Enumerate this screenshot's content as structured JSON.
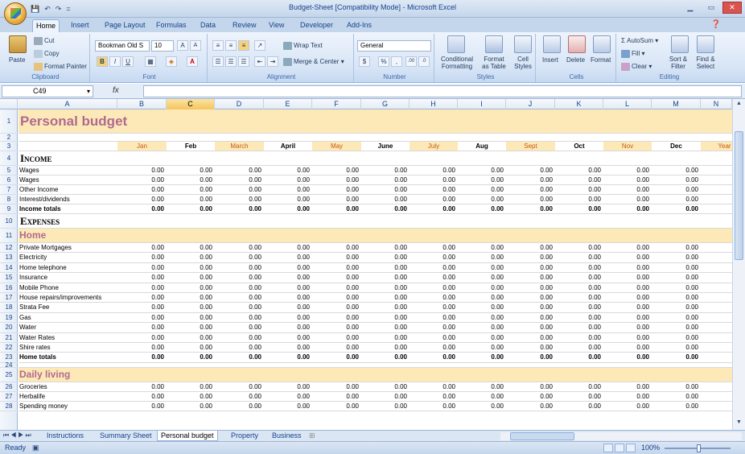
{
  "window": {
    "title": "Budget-Sheet  [Compatibility Mode] - Microsoft Excel"
  },
  "qat": {
    "save": "💾",
    "undo": "↶",
    "redo": "↷",
    "more": "="
  },
  "ribbon_tabs": [
    "Home",
    "Insert",
    "Page Layout",
    "Formulas",
    "Data",
    "Review",
    "View",
    "Developer",
    "Add-Ins"
  ],
  "ribbon": {
    "clipboard": {
      "label": "Clipboard",
      "paste": "Paste",
      "cut": "Cut",
      "copy": "Copy",
      "format_painter": "Format Painter"
    },
    "font": {
      "label": "Font",
      "name": "Bookman Old S",
      "size": "10",
      "bold": "B",
      "italic": "I",
      "underline": "U",
      "grow": "A",
      "shrink": "A"
    },
    "alignment": {
      "label": "Alignment",
      "wrap_text": "Wrap Text",
      "merge_center": "Merge & Center"
    },
    "number": {
      "label": "Number",
      "format": "General",
      "percent": "%",
      "comma": ","
    },
    "styles": {
      "label": "Styles",
      "conditional": "Conditional",
      "conditional2": "Formatting",
      "format_table": "Format",
      "format_table2": "as Table",
      "cell_styles": "Cell",
      "cell_styles2": "Styles"
    },
    "cells": {
      "label": "Cells",
      "insert": "Insert",
      "delete": "Delete",
      "format": "Format"
    },
    "editing": {
      "label": "Editing",
      "autosum": "AutoSum",
      "fill": "Fill",
      "clear": "Clear",
      "sort": "Sort &",
      "sort2": "Filter",
      "find": "Find &",
      "find2": "Select"
    }
  },
  "formula_bar": {
    "name_box": "C49",
    "fx": "fx",
    "value": ""
  },
  "columns": [
    "A",
    "B",
    "C",
    "D",
    "E",
    "F",
    "G",
    "H",
    "I",
    "J",
    "K",
    "L",
    "M",
    "N"
  ],
  "selected_column": "C",
  "months": [
    "Jan",
    "Feb",
    "March",
    "April",
    "May",
    "June",
    "July",
    "Aug",
    "Sept",
    "Oct",
    "Nov",
    "Dec",
    "Year"
  ],
  "sheet": {
    "title": "Personal budget",
    "income_header": "Income",
    "income_rows": [
      "Wages",
      "Wages",
      "Other Income",
      "Interest/dividends"
    ],
    "income_total": "Income totals",
    "expenses_header": "Expenses",
    "home_header": "Home",
    "home_rows": [
      "Private Mortgages",
      "Electricity",
      "Home telephone",
      "Insurance",
      "Mobile Phone",
      "House repairs/improvements",
      "Strata Fee",
      "Gas",
      "Water",
      "Water Rates",
      "Shire rates"
    ],
    "home_total": "Home totals",
    "daily_header": "Daily living",
    "daily_rows": [
      "Groceries",
      "Herbalife",
      "Spending money"
    ],
    "zero": "0.00"
  },
  "sheet_tabs": [
    "Instructions",
    "Summary Sheet",
    "Personal budget",
    "Property",
    "Business"
  ],
  "active_sheet": "Personal budget",
  "status": {
    "text": "Ready",
    "zoom": "100%"
  },
  "colors": {
    "accent_orange": "#c55a11",
    "band": "#fde9b8",
    "title_mauve": "#b06a8e",
    "ribbon": "#c4d6ec"
  }
}
